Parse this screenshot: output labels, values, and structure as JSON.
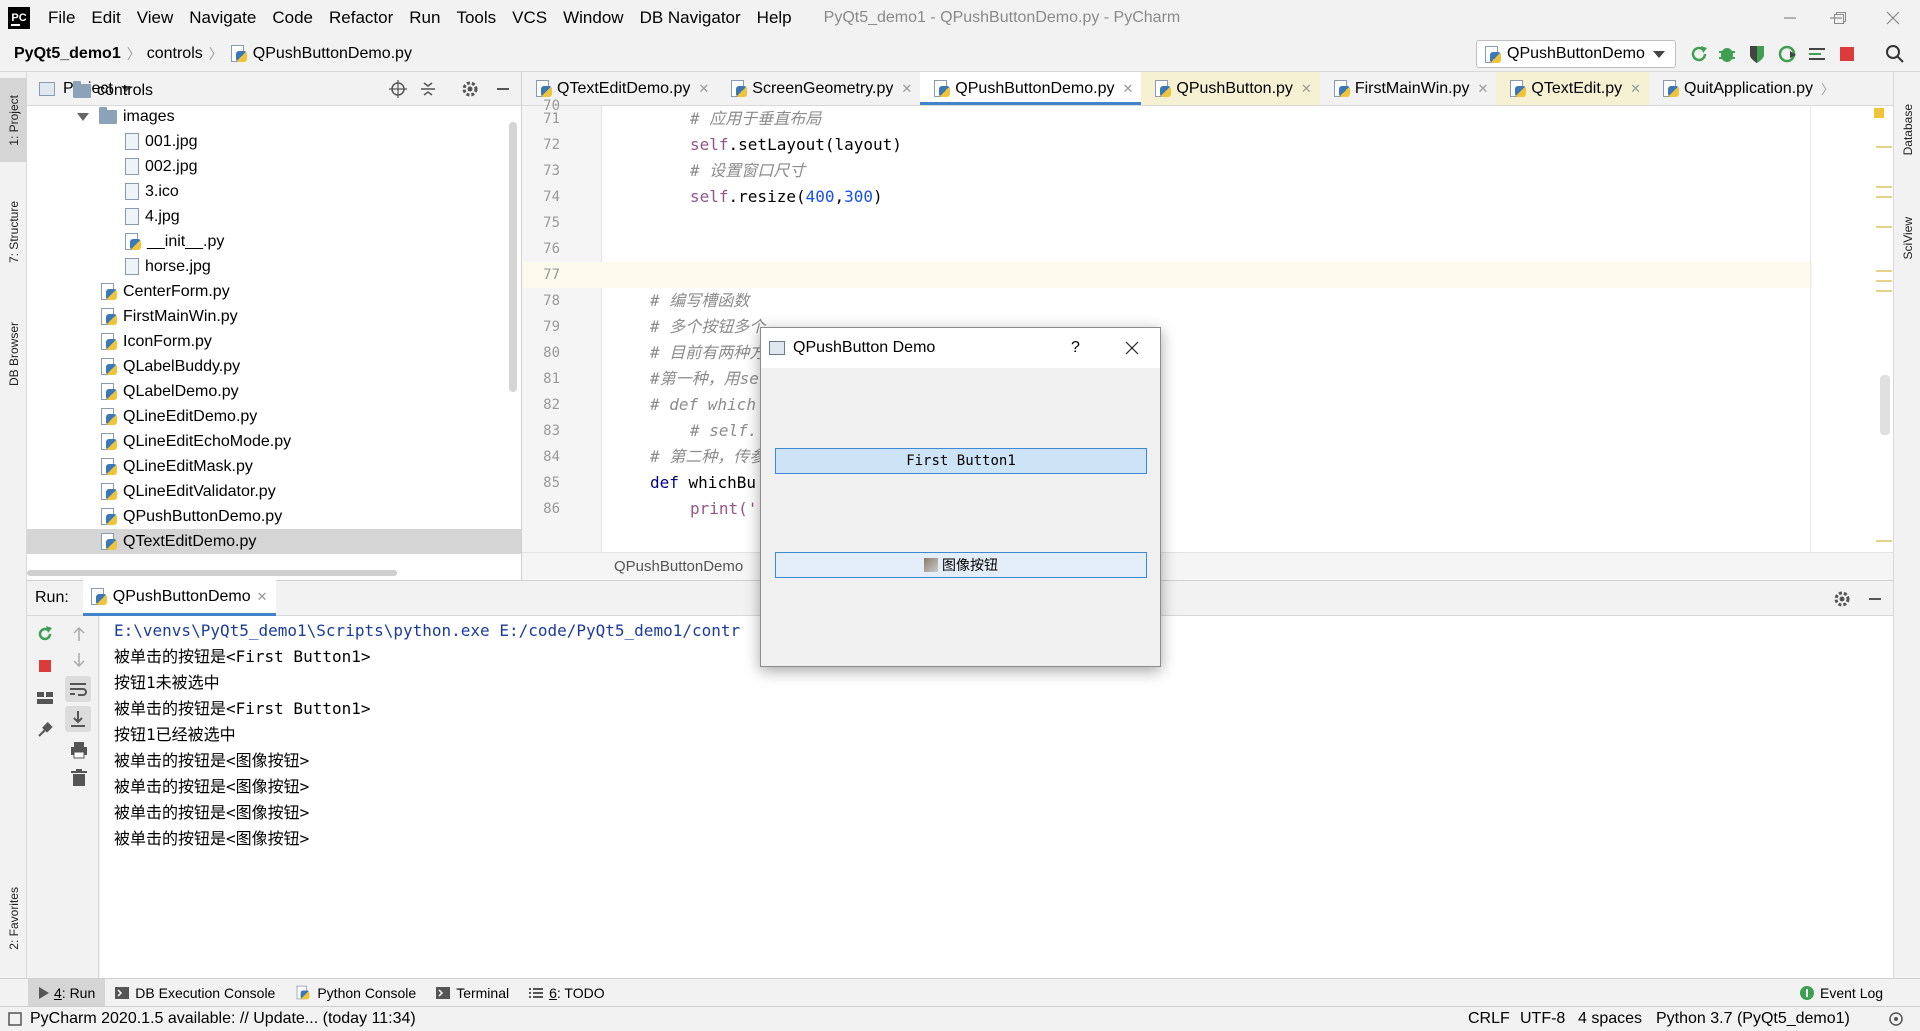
{
  "menubar": {
    "items": [
      "File",
      "Edit",
      "View",
      "Navigate",
      "Code",
      "Refactor",
      "Run",
      "Tools",
      "VCS",
      "Window",
      "DB Navigator",
      "Help"
    ],
    "window_title": "PyQt5_demo1 - QPushButtonDemo.py - PyCharm"
  },
  "navbar": {
    "breadcrumb": [
      "PyQt5_demo1",
      "controls",
      "QPushButtonDemo.py"
    ],
    "run_config": "QPushButtonDemo"
  },
  "left_stripe": [
    "1: Project",
    "7: Structure",
    "DB Browser",
    "2: Favorites"
  ],
  "right_stripe": [
    "Database",
    "SciView"
  ],
  "project": {
    "title": "Project",
    "tree": [
      {
        "label": "controls",
        "kind": "folder"
      },
      {
        "label": "images",
        "kind": "folder"
      },
      {
        "label": "001.jpg",
        "kind": "file"
      },
      {
        "label": "002.jpg",
        "kind": "file"
      },
      {
        "label": "3.ico",
        "kind": "file"
      },
      {
        "label": "4.jpg",
        "kind": "file"
      },
      {
        "label": "__init__.py",
        "kind": "py"
      },
      {
        "label": "horse.jpg",
        "kind": "file"
      },
      {
        "label": "CenterForm.py",
        "kind": "py"
      },
      {
        "label": "FirstMainWin.py",
        "kind": "py"
      },
      {
        "label": "IconForm.py",
        "kind": "py"
      },
      {
        "label": "QLabelBuddy.py",
        "kind": "py"
      },
      {
        "label": "QLabelDemo.py",
        "kind": "py"
      },
      {
        "label": "QLineEditDemo.py",
        "kind": "py"
      },
      {
        "label": "QLineEditEchoMode.py",
        "kind": "py"
      },
      {
        "label": "QLineEditMask.py",
        "kind": "py"
      },
      {
        "label": "QLineEditValidator.py",
        "kind": "py"
      },
      {
        "label": "QPushButtonDemo.py",
        "kind": "py"
      },
      {
        "label": "QTextEditDemo.py",
        "kind": "py"
      }
    ]
  },
  "editor": {
    "tabs": [
      "QTextEditDemo.py",
      "ScreenGeometry.py",
      "QPushButtonDemo.py",
      "QPushButton.py",
      "FirstMainWin.py",
      "QTextEdit.py",
      "QuitApplication.py"
    ],
    "line_numbers": [
      "70",
      "71",
      "72",
      "73",
      "74",
      "75",
      "76",
      "77",
      "78",
      "79",
      "80",
      "81",
      "82",
      "83",
      "84",
      "85",
      "86"
    ],
    "lines": {
      "l71": "# 应用于垂直布局",
      "l72_self": "self",
      "l72_rest": ".setLayout(layout)",
      "l73": "# 设置窗口尺寸",
      "l74_self": "self",
      "l74_mid": ".resize(",
      "l74_n1": "400",
      "l74_comma": ",",
      "l74_n2": "300",
      "l74_end": ")",
      "l78": "# 编写槽函数",
      "l79": "# 多个按钮多个",
      "l80": "# 目前有两种方",
      "l81": "#第一种，用se",
      "l82": "# def which",
      "l83": "# self.",
      "l84": "# 第二种，传参",
      "l85_kw": "def",
      "l85_rest": " whichBu",
      "l86": "print('"
    },
    "breadcrumb": "QPushButtonDemo"
  },
  "run": {
    "label": "Run:",
    "tab": "QPushButtonDemo",
    "console": [
      "E:\\venvs\\PyQt5_demo1\\Scripts\\python.exe E:/code/PyQt5_demo1/contr",
      "被单击的按钮是<First Button1>",
      "按钮1未被选中",
      "被单击的按钮是<First Button1>",
      "按钮1已经被选中",
      "被单击的按钮是<图像按钮>",
      "被单击的按钮是<图像按钮>",
      "被单击的按钮是<图像按钮>",
      "被单击的按钮是<图像按钮>"
    ]
  },
  "dialog": {
    "title": "QPushButton Demo",
    "help": "?",
    "button1": "First Button1",
    "button2": "图像按钮"
  },
  "bottom_tools": {
    "run_num": "4",
    "run": ": Run",
    "db_console": "DB Execution Console",
    "python_console": "Python Console",
    "terminal": "Terminal",
    "todo_num": "6",
    "todo": ": TODO",
    "event_log": "Event Log"
  },
  "status": {
    "update": "PyCharm 2020.1.5 available: // Update... (today 11:34)",
    "line_sep": "CRLF",
    "encoding": "UTF-8",
    "indent": "4 spaces",
    "interpreter": "Python 3.7 (PyQt5_demo1)"
  },
  "colors": {
    "accent": "#4083c9",
    "run_green": "#3e9f50",
    "stop_red": "#db3b3b"
  }
}
